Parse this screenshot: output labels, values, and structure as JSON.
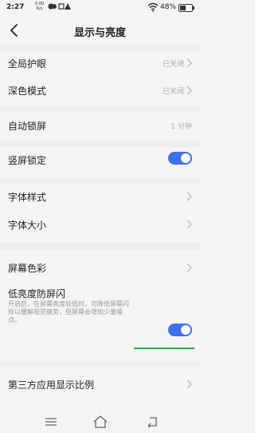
{
  "status": {
    "time": "2:27",
    "netspeed_value": "0.00",
    "netspeed_unit": "K/s",
    "battery_pct": "48%",
    "battery_level": 0.48
  },
  "header": {
    "title": "显示与亮度"
  },
  "settings": {
    "eye_protection": {
      "label": "全局护眼",
      "value": "已关闭"
    },
    "dark_mode": {
      "label": "深色模式",
      "value": "已关闭"
    },
    "auto_lock": {
      "label": "自动锁屏",
      "value": "1 分钟"
    },
    "portrait_lock": {
      "label": "竖屏锁定",
      "enabled": true
    },
    "font_style": {
      "label": "字体样式"
    },
    "font_size": {
      "label": "字体大小"
    },
    "screen_color": {
      "label": "屏幕色彩"
    },
    "low_brightness_flicker": {
      "label": "低亮度防屏闪",
      "description_line1": "开启后，在屏幕亮度较低时，可降低屏幕闪",
      "description_line2": "烁以缓解视觉疲劳，但屏幕会增加少量噪",
      "description_line3": "点。",
      "enabled": true
    },
    "third_party_ratio": {
      "label": "第三方应用显示比例"
    }
  },
  "colors": {
    "accent": "#3d6fe6",
    "highlight": "#21b04b"
  }
}
